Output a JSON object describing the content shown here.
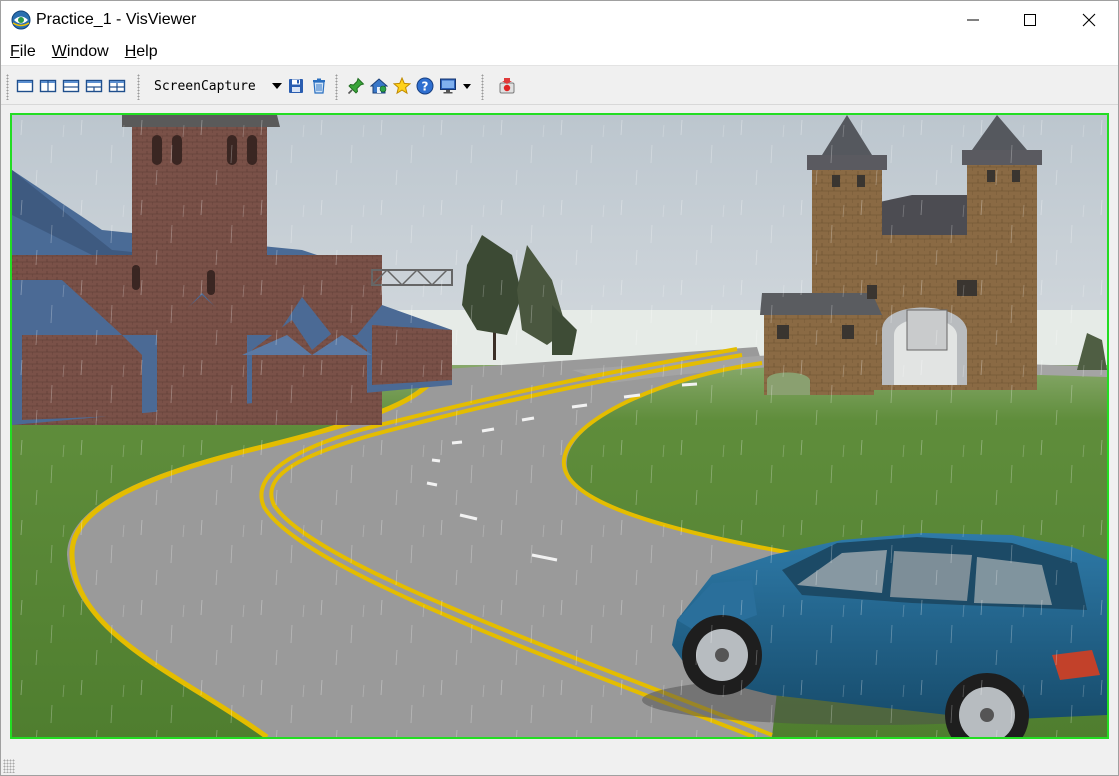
{
  "window": {
    "title": "Practice_1 - VisViewer",
    "controls": {
      "minimize": "minimize-icon",
      "maximize": "maximize-icon",
      "close": "close-icon"
    }
  },
  "menu": {
    "items": [
      {
        "label": "File",
        "accel": "F",
        "rest": "ile"
      },
      {
        "label": "Window",
        "accel": "W",
        "rest": "indow"
      },
      {
        "label": "Help",
        "accel": "H",
        "rest": "elp"
      }
    ]
  },
  "toolbar": {
    "layout_buttons": [
      "layout-single-icon",
      "layout-two-columns-icon",
      "layout-two-rows-icon",
      "layout-three-views-icon",
      "layout-four-views-icon"
    ],
    "capture_mode": "ScreenCapture",
    "capture_buttons": [
      "save-icon",
      "clear-icon"
    ],
    "tool_buttons": [
      "pin-icon",
      "home-view-icon",
      "star-icon",
      "help-icon",
      "monitor-icon"
    ],
    "extra_buttons": [
      "record-icon"
    ]
  },
  "viewport": {
    "border_color": "#22dd22",
    "scene": "3d-driving-scene"
  },
  "colors": {
    "accent": "#22dd22",
    "road_line": "#e6bf00",
    "car": "#1f5f86",
    "grass": "#5f8f3a",
    "sky": "#d8dde2"
  }
}
